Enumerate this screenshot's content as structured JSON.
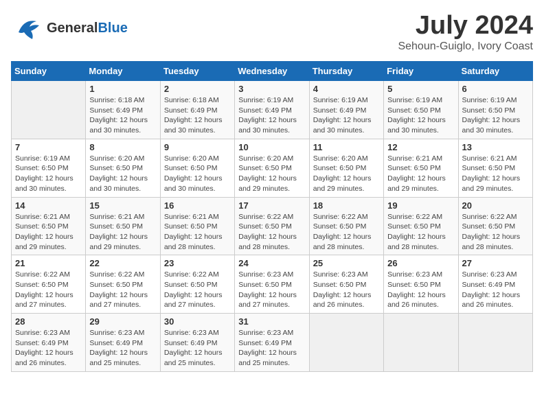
{
  "logo": {
    "general": "General",
    "blue": "Blue",
    "bird_symbol": "🐦"
  },
  "title": "July 2024",
  "subtitle": "Sehoun-Guiglo, Ivory Coast",
  "calendar": {
    "headers": [
      "Sunday",
      "Monday",
      "Tuesday",
      "Wednesday",
      "Thursday",
      "Friday",
      "Saturday"
    ],
    "weeks": [
      [
        {
          "day": "",
          "info": ""
        },
        {
          "day": "1",
          "info": "Sunrise: 6:18 AM\nSunset: 6:49 PM\nDaylight: 12 hours\nand 30 minutes."
        },
        {
          "day": "2",
          "info": "Sunrise: 6:18 AM\nSunset: 6:49 PM\nDaylight: 12 hours\nand 30 minutes."
        },
        {
          "day": "3",
          "info": "Sunrise: 6:19 AM\nSunset: 6:49 PM\nDaylight: 12 hours\nand 30 minutes."
        },
        {
          "day": "4",
          "info": "Sunrise: 6:19 AM\nSunset: 6:49 PM\nDaylight: 12 hours\nand 30 minutes."
        },
        {
          "day": "5",
          "info": "Sunrise: 6:19 AM\nSunset: 6:50 PM\nDaylight: 12 hours\nand 30 minutes."
        },
        {
          "day": "6",
          "info": "Sunrise: 6:19 AM\nSunset: 6:50 PM\nDaylight: 12 hours\nand 30 minutes."
        }
      ],
      [
        {
          "day": "7",
          "info": "Sunrise: 6:19 AM\nSunset: 6:50 PM\nDaylight: 12 hours\nand 30 minutes."
        },
        {
          "day": "8",
          "info": "Sunrise: 6:20 AM\nSunset: 6:50 PM\nDaylight: 12 hours\nand 30 minutes."
        },
        {
          "day": "9",
          "info": "Sunrise: 6:20 AM\nSunset: 6:50 PM\nDaylight: 12 hours\nand 30 minutes."
        },
        {
          "day": "10",
          "info": "Sunrise: 6:20 AM\nSunset: 6:50 PM\nDaylight: 12 hours\nand 29 minutes."
        },
        {
          "day": "11",
          "info": "Sunrise: 6:20 AM\nSunset: 6:50 PM\nDaylight: 12 hours\nand 29 minutes."
        },
        {
          "day": "12",
          "info": "Sunrise: 6:21 AM\nSunset: 6:50 PM\nDaylight: 12 hours\nand 29 minutes."
        },
        {
          "day": "13",
          "info": "Sunrise: 6:21 AM\nSunset: 6:50 PM\nDaylight: 12 hours\nand 29 minutes."
        }
      ],
      [
        {
          "day": "14",
          "info": "Sunrise: 6:21 AM\nSunset: 6:50 PM\nDaylight: 12 hours\nand 29 minutes."
        },
        {
          "day": "15",
          "info": "Sunrise: 6:21 AM\nSunset: 6:50 PM\nDaylight: 12 hours\nand 29 minutes."
        },
        {
          "day": "16",
          "info": "Sunrise: 6:21 AM\nSunset: 6:50 PM\nDaylight: 12 hours\nand 28 minutes."
        },
        {
          "day": "17",
          "info": "Sunrise: 6:22 AM\nSunset: 6:50 PM\nDaylight: 12 hours\nand 28 minutes."
        },
        {
          "day": "18",
          "info": "Sunrise: 6:22 AM\nSunset: 6:50 PM\nDaylight: 12 hours\nand 28 minutes."
        },
        {
          "day": "19",
          "info": "Sunrise: 6:22 AM\nSunset: 6:50 PM\nDaylight: 12 hours\nand 28 minutes."
        },
        {
          "day": "20",
          "info": "Sunrise: 6:22 AM\nSunset: 6:50 PM\nDaylight: 12 hours\nand 28 minutes."
        }
      ],
      [
        {
          "day": "21",
          "info": "Sunrise: 6:22 AM\nSunset: 6:50 PM\nDaylight: 12 hours\nand 27 minutes."
        },
        {
          "day": "22",
          "info": "Sunrise: 6:22 AM\nSunset: 6:50 PM\nDaylight: 12 hours\nand 27 minutes."
        },
        {
          "day": "23",
          "info": "Sunrise: 6:22 AM\nSunset: 6:50 PM\nDaylight: 12 hours\nand 27 minutes."
        },
        {
          "day": "24",
          "info": "Sunrise: 6:23 AM\nSunset: 6:50 PM\nDaylight: 12 hours\nand 27 minutes."
        },
        {
          "day": "25",
          "info": "Sunrise: 6:23 AM\nSunset: 6:50 PM\nDaylight: 12 hours\nand 26 minutes."
        },
        {
          "day": "26",
          "info": "Sunrise: 6:23 AM\nSunset: 6:50 PM\nDaylight: 12 hours\nand 26 minutes."
        },
        {
          "day": "27",
          "info": "Sunrise: 6:23 AM\nSunset: 6:49 PM\nDaylight: 12 hours\nand 26 minutes."
        }
      ],
      [
        {
          "day": "28",
          "info": "Sunrise: 6:23 AM\nSunset: 6:49 PM\nDaylight: 12 hours\nand 26 minutes."
        },
        {
          "day": "29",
          "info": "Sunrise: 6:23 AM\nSunset: 6:49 PM\nDaylight: 12 hours\nand 25 minutes."
        },
        {
          "day": "30",
          "info": "Sunrise: 6:23 AM\nSunset: 6:49 PM\nDaylight: 12 hours\nand 25 minutes."
        },
        {
          "day": "31",
          "info": "Sunrise: 6:23 AM\nSunset: 6:49 PM\nDaylight: 12 hours\nand 25 minutes."
        },
        {
          "day": "",
          "info": ""
        },
        {
          "day": "",
          "info": ""
        },
        {
          "day": "",
          "info": ""
        }
      ]
    ]
  }
}
